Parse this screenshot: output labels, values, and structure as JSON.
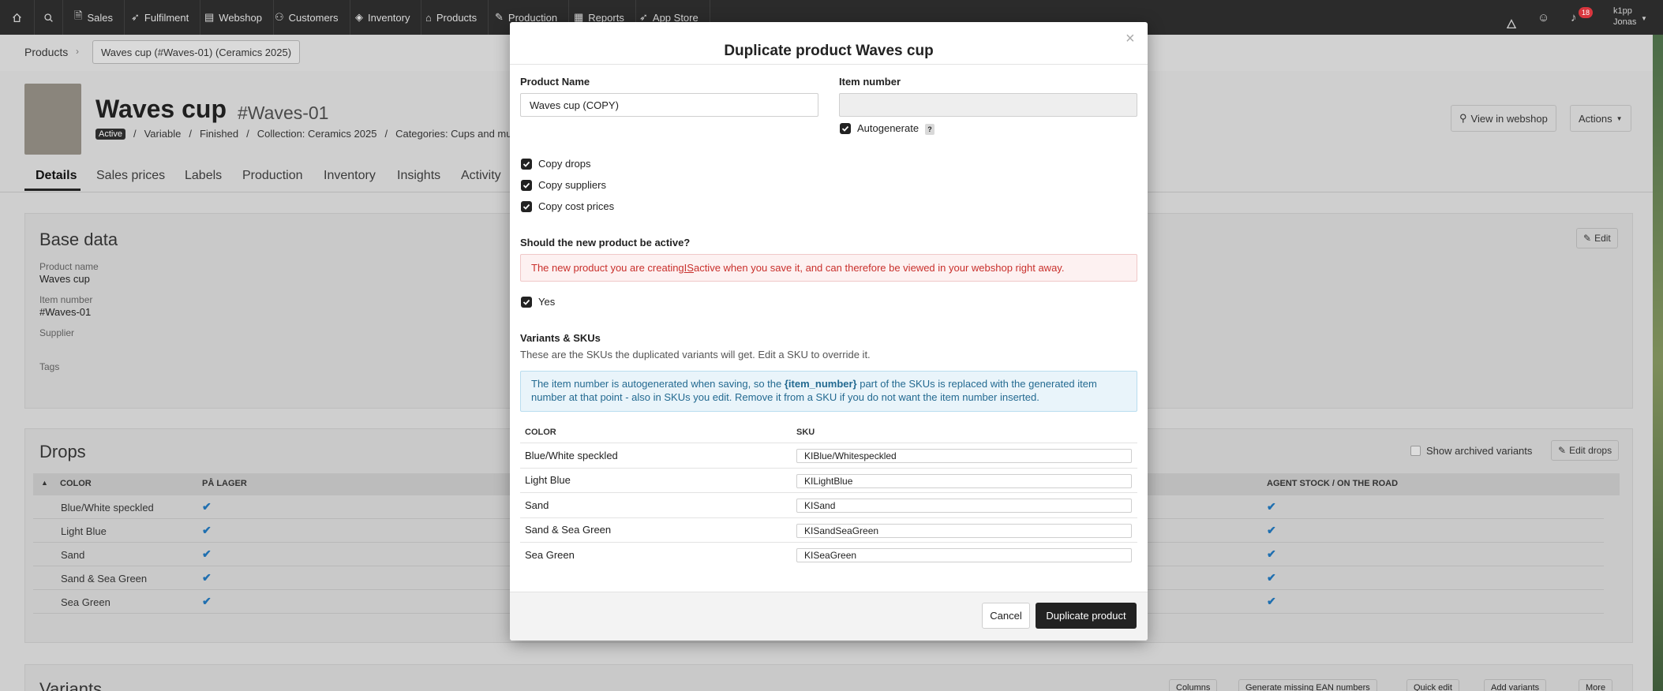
{
  "nav": {
    "items": [
      "Sales",
      "Fulfilment",
      "Webshop",
      "Customers",
      "Inventory",
      "Products",
      "Production",
      "Reports",
      "App Store"
    ],
    "user_login": "k1pp",
    "user_name": "Jonas",
    "notifications": "18"
  },
  "breadcrumb": {
    "root": "Products",
    "current": "Waves cup (#Waves-01) (Ceramics 2025)"
  },
  "product": {
    "title": "Waves cup",
    "sku": "#Waves-01",
    "status": "Active",
    "meta": [
      "Variable",
      "Finished",
      "Collection: Ceramics 2025",
      "Categories: Cups and mugs, C"
    ],
    "view_webshop": "View in webshop",
    "actions": "Actions"
  },
  "tabs": [
    "Details",
    "Sales prices",
    "Labels",
    "Production",
    "Inventory",
    "Insights",
    "Activity"
  ],
  "base_data": {
    "title": "Base data",
    "edit": "Edit",
    "product_name_label": "Product name",
    "product_name": "Waves cup",
    "item_number_label": "Item number",
    "item_number": "#Waves-01",
    "supplier_label": "Supplier",
    "tags_label": "Tags"
  },
  "drops": {
    "title": "Drops",
    "show_archived": "Show archived variants",
    "edit_drops": "Edit drops",
    "col_color": "COLOR",
    "col_stock": "PÅ LAGER",
    "col_agent": "AGENT STOCK / ON THE ROAD",
    "rows": [
      "Blue/White speckled",
      "Light Blue",
      "Sand",
      "Sand & Sea Green",
      "Sea Green"
    ]
  },
  "variants": {
    "title": "Variants",
    "buttons": [
      "Columns",
      "Generate missing EAN numbers",
      "Quick edit",
      "Add variants",
      "More"
    ]
  },
  "modal": {
    "title": "Duplicate product Waves cup",
    "close": "×",
    "product_name_label": "Product Name",
    "product_name_value": "Waves cup (COPY)",
    "item_number_label": "Item number",
    "item_number_value": "",
    "autogenerate_label": "Autogenerate",
    "help": "?",
    "copy_drops": "Copy drops",
    "copy_suppliers": "Copy suppliers",
    "copy_cost_prices": "Copy cost prices",
    "active_question": "Should the new product be active?",
    "active_warning_pre": "The new product you are creating ",
    "active_warning_is": "IS",
    "active_warning_post": " active when you save it, and can therefore be viewed in your webshop right away.",
    "yes_label": "Yes",
    "variants_title": "Variants & SKUs",
    "variants_sub": "These are the SKUs the duplicated variants will get. Edit a SKU to override it.",
    "info_pre": "The item number is autogenerated when saving, so the ",
    "info_bold": "{item_number}",
    "info_post": " part of the SKUs is replaced with the generated item number at that point - also in SKUs you edit. Remove it from a SKU if you do not want the item number inserted.",
    "col_color": "COLOR",
    "col_sku": "SKU",
    "rows": [
      {
        "color": "Blue/White speckled",
        "sku": "KIBlue/Whitespeckled"
      },
      {
        "color": "Light Blue",
        "sku": "KILightBlue"
      },
      {
        "color": "Sand",
        "sku": "KISand"
      },
      {
        "color": "Sand & Sea Green",
        "sku": "KISandSeaGreen"
      },
      {
        "color": "Sea Green",
        "sku": "KISeaGreen"
      }
    ],
    "cancel": "Cancel",
    "submit": "Duplicate product"
  }
}
